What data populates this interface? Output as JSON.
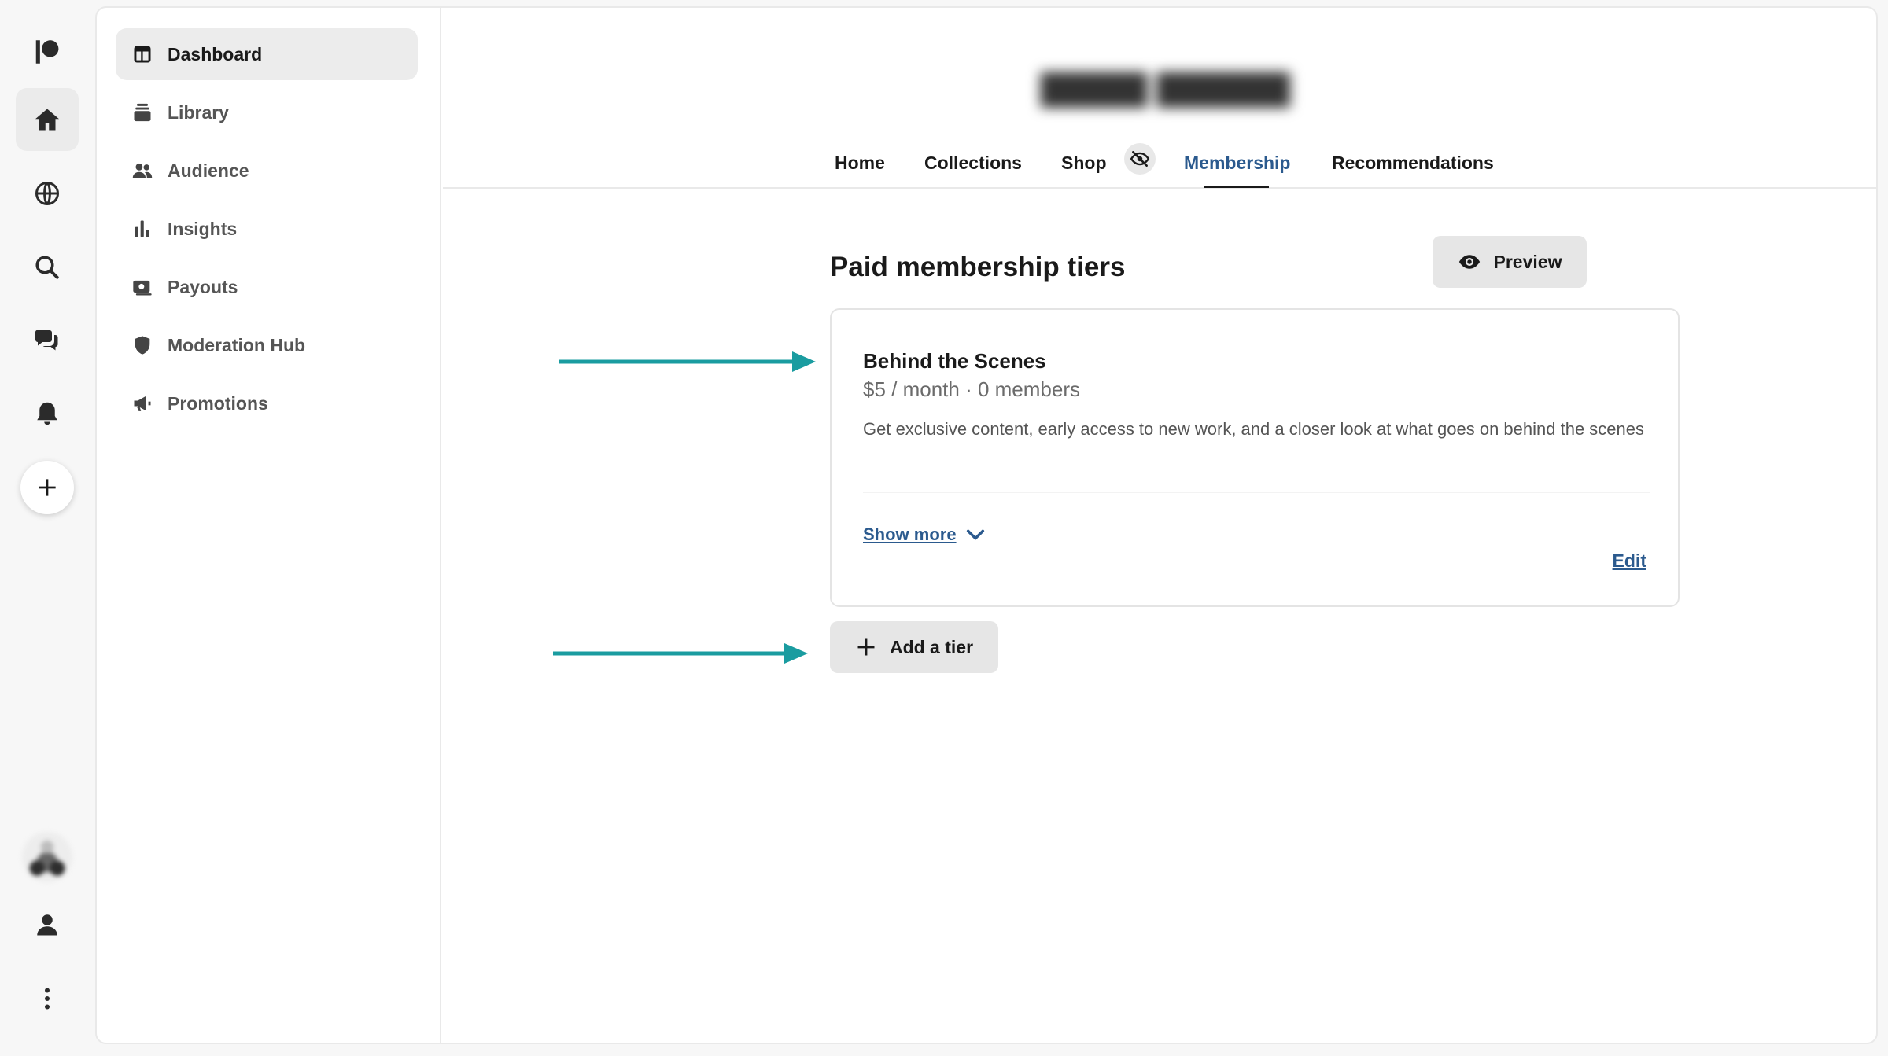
{
  "sidebar": {
    "items": [
      {
        "label": "Dashboard",
        "icon": "dashboard-icon",
        "active": true
      },
      {
        "label": "Library",
        "icon": "library-icon"
      },
      {
        "label": "Audience",
        "icon": "audience-icon"
      },
      {
        "label": "Insights",
        "icon": "insights-icon"
      },
      {
        "label": "Payouts",
        "icon": "payouts-icon"
      },
      {
        "label": "Moderation Hub",
        "icon": "shield-icon"
      },
      {
        "label": "Promotions",
        "icon": "megaphone-icon"
      }
    ]
  },
  "rail": {
    "icons": [
      "patreon-logo-icon",
      "home-icon",
      "globe-icon",
      "search-icon",
      "chat-icon",
      "bell-icon",
      "plus-icon",
      "avatar",
      "user-icon",
      "more-vertical-icon"
    ]
  },
  "tabs": [
    {
      "label": "Home"
    },
    {
      "label": "Collections"
    },
    {
      "label": "Shop",
      "badge_icon": "eye-off-icon"
    },
    {
      "label": "Membership",
      "active": true
    },
    {
      "label": "Recommendations"
    }
  ],
  "main": {
    "title": "Paid membership tiers",
    "preview_label": "Preview",
    "add_tier_label": "Add a tier"
  },
  "tier": {
    "name": "Behind the Scenes",
    "price": "$5 / month · 0 members",
    "description": "Get exclusive content, early access to new work, and a closer look at what goes on behind the scenes",
    "show_more_label": "Show more",
    "edit_label": "Edit"
  },
  "colors": {
    "accent_link": "#2b5a8e",
    "annotation_arrow": "#1a9ca0",
    "button_bg": "#e6e6e6"
  }
}
